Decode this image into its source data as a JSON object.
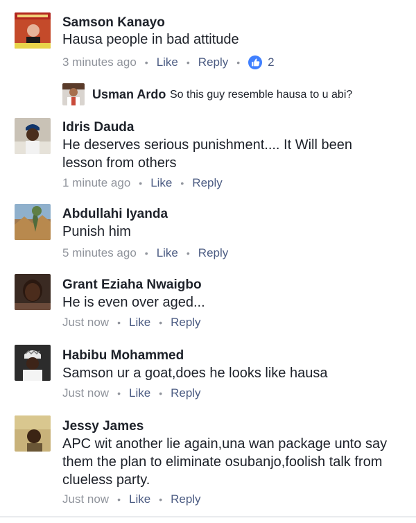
{
  "comments": [
    {
      "name": "Samson Kanayo",
      "text": "Hausa people in bad attitude",
      "time": "3 minutes ago",
      "like": "Like",
      "reply": "Reply",
      "reaction_count": "2",
      "reply_item": {
        "name": "Usman Ardo",
        "text": "So this guy resemble hausa to u abi?"
      }
    },
    {
      "name": "Idris Dauda",
      "text": "He deserves serious punishment.... It Will been\nlesson from others",
      "time": "1 minute ago",
      "like": "Like",
      "reply": "Reply"
    },
    {
      "name": "Abdullahi Iyanda",
      "text": "Punish him",
      "time": "5 minutes ago",
      "like": "Like",
      "reply": "Reply"
    },
    {
      "name": "Grant Eziaha Nwaigbo",
      "text": "He is even over aged...",
      "time": "Just now",
      "like": "Like",
      "reply": "Reply"
    },
    {
      "name": "Habibu Mohammed",
      "text": "Samson ur a goat,does he looks like hausa",
      "time": "Just now",
      "like": "Like",
      "reply": "Reply"
    },
    {
      "name": "Jessy James",
      "text": "APC wit another lie again,una wan package unto say\nthem the plan to  eliminate osubanjo,foolish talk from\nclueless party.",
      "time": "Just now",
      "like": "Like",
      "reply": "Reply"
    }
  ],
  "colors": {
    "name": "#1d2129",
    "meta": "#90949c",
    "action": "#4b5b82",
    "like_bubble": "#4080ff"
  },
  "icons": {
    "reaction": "thumbs-up-icon"
  }
}
